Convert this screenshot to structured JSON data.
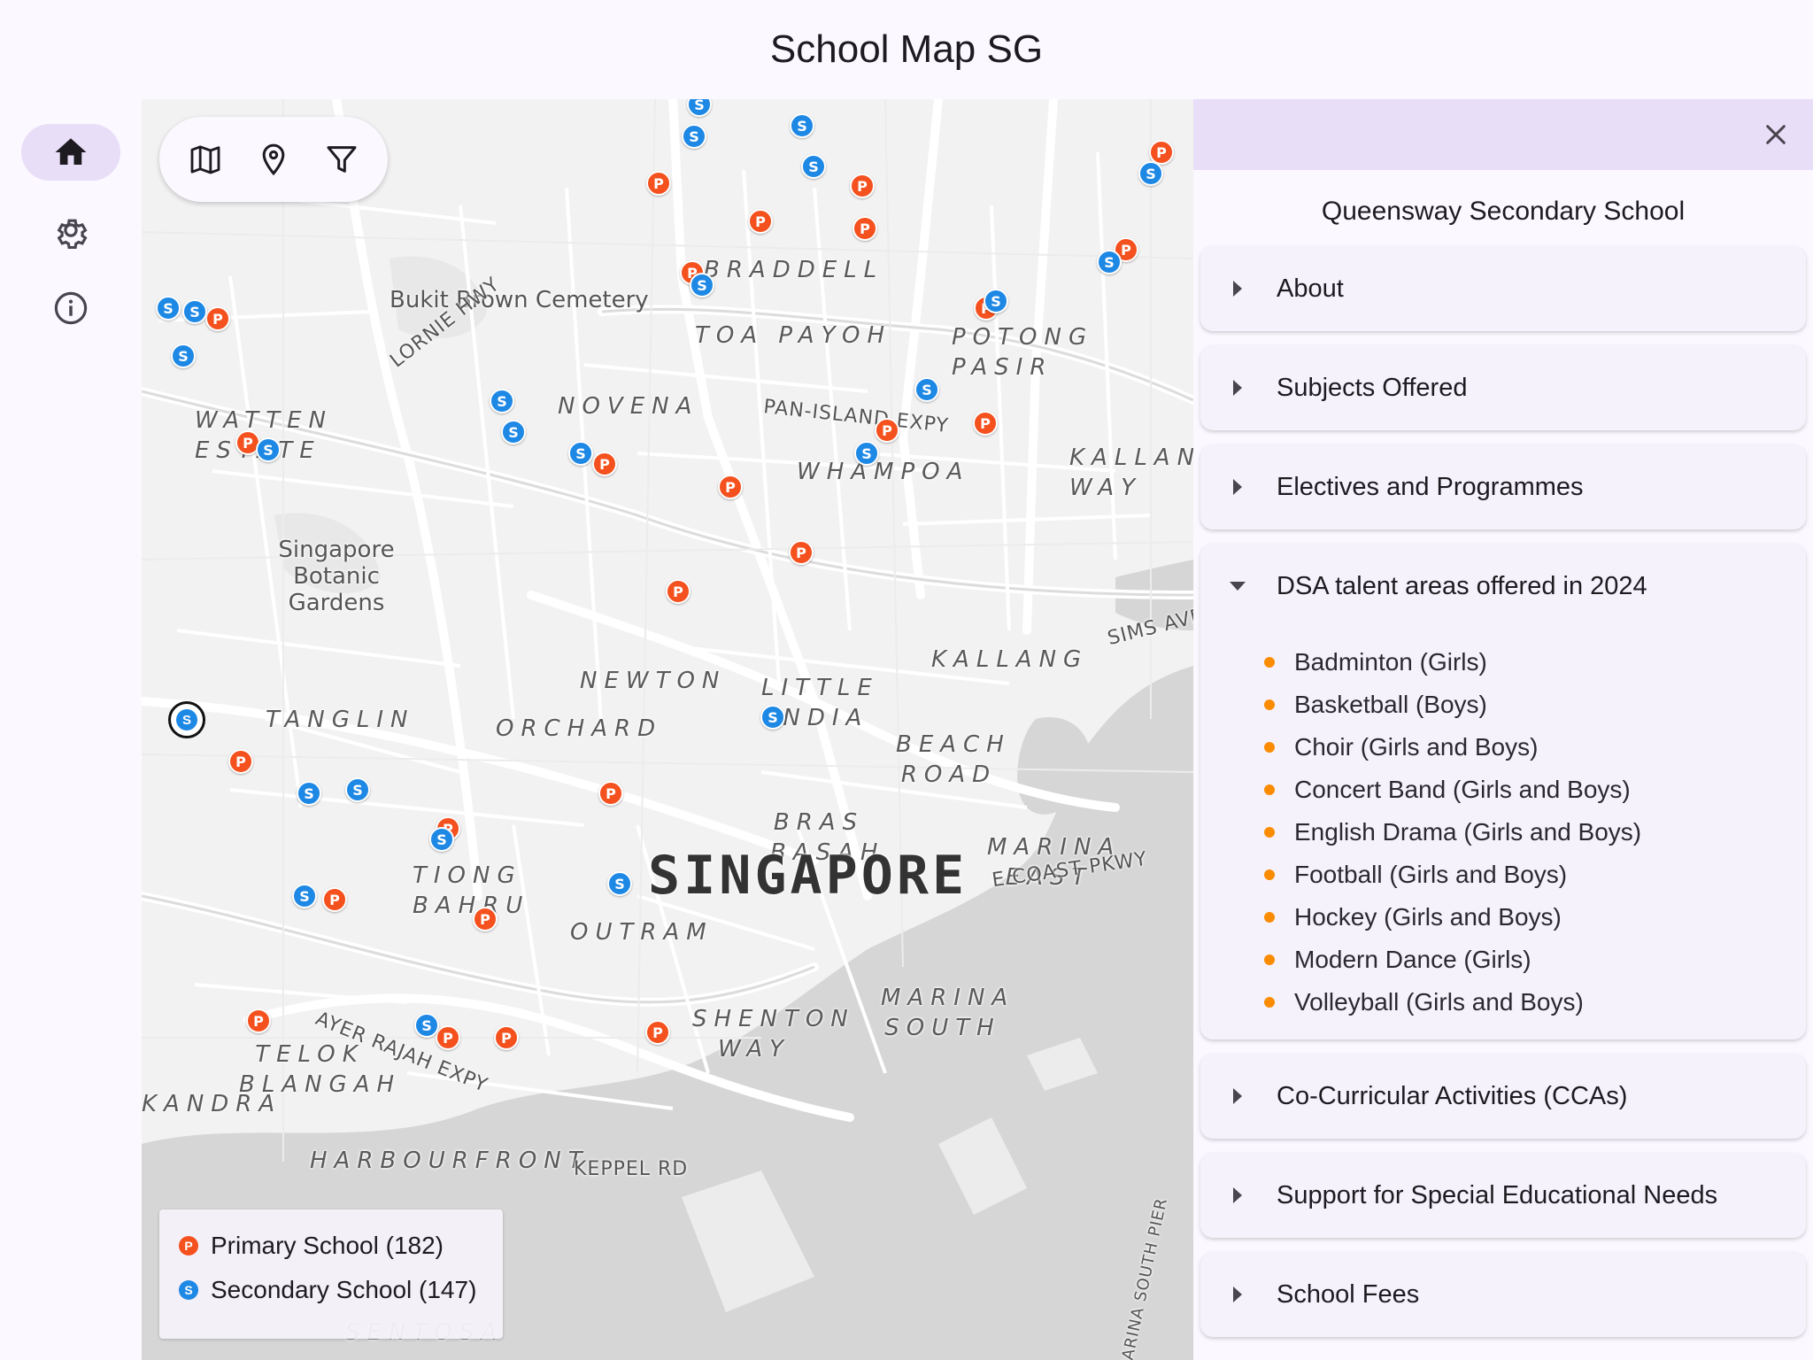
{
  "app": {
    "title": "School Map SG"
  },
  "rail": [
    {
      "name": "home",
      "icon": "home-icon",
      "active": true
    },
    {
      "name": "settings",
      "icon": "gear-icon",
      "active": false
    },
    {
      "name": "info",
      "icon": "info-icon",
      "active": false
    }
  ],
  "map": {
    "toolbar": [
      "map-icon",
      "location-pin-icon",
      "filter-icon"
    ],
    "labels": {
      "bukit_brown": "Bukit Brown Cemetery",
      "botanic": "Singapore Botanic Gardens",
      "novena": "NOVENA",
      "braddell": "BRADDELL",
      "toa_payoh": "TOA PAYOH",
      "potong_pasir": "POTONG PASIR",
      "whampoa": "WHAMPOA",
      "kallang_way": "KALLANG WAY",
      "kallang": "KALLANG",
      "little_india": "LITTLE INDIA",
      "newton": "NEWTON",
      "orchard": "ORCHARD",
      "tanglin": "TANGLIN",
      "watten": "WATTEN ESTATE",
      "beach_road": "BEACH ROAD",
      "bras_basah": "BRAS BASAH",
      "singapore": "SINGAPORE",
      "marina_east": "MARINA EAST",
      "tiong_bahru": "TIONG BAHRU",
      "outram": "OUTRAM",
      "marina_south": "MARINA SOUTH",
      "shenton_way": "SHENTON WAY",
      "telok_blangah": "TELOK BLANGAH",
      "harbourfront": "HARBOURFRONT",
      "sentosa": "SENTOSA",
      "lornie_hwy": "LORNIE HWY",
      "pie": "PAN-ISLAND EXPY",
      "ecp": "E COAST PKWY",
      "aye": "AYER RAJAH EXPY",
      "keppel": "KEPPEL RD",
      "sims": "SIMS AVE",
      "alexandra": "KANDRA",
      "marina_south_pier": "MARINA SOUTH PIER"
    },
    "legend": {
      "primary": {
        "label": "Primary School (182)",
        "symbol": "P",
        "color": "#f4511e"
      },
      "secondary": {
        "label": "Secondary School (147)",
        "symbol": "S",
        "color": "#1e88e5"
      }
    }
  },
  "panel": {
    "school_name": "Queensway Secondary School",
    "sections": {
      "about": "About",
      "subjects": "Subjects Offered",
      "electives": "Electives and Programmes",
      "dsa": "DSA talent areas offered in 2024",
      "cca": "Co-Curricular Activities (CCAs)",
      "sen": "Support for Special Educational Needs",
      "fees": "School Fees"
    },
    "dsa_items": [
      "Badminton (Girls)",
      "Basketball (Boys)",
      "Choir (Girls and Boys)",
      "Concert Band (Girls and Boys)",
      "English Drama (Girls and Boys)",
      "Football (Girls and Boys)",
      "Hockey (Girls and Boys)",
      "Modern Dance (Girls)",
      "Volleyball (Girls and Boys)"
    ]
  }
}
